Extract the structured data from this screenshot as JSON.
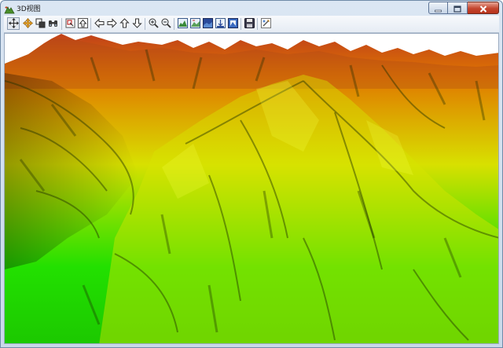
{
  "window": {
    "title": "3D视图",
    "icon": "app-icon",
    "caption_buttons": [
      {
        "name": "minimize-button",
        "icon": "minimize-icon"
      },
      {
        "name": "maximize-button",
        "icon": "maximize-icon"
      },
      {
        "name": "close-button",
        "icon": "close-icon"
      }
    ]
  },
  "toolbar": {
    "buttons": [
      {
        "name": "select-tool-button",
        "icon": "select-arrow-icon",
        "pressed": true
      },
      {
        "name": "pan-tool-button",
        "icon": "pan-icon"
      },
      {
        "name": "zoom-box-button",
        "icon": "zoom-box-icon"
      },
      {
        "name": "fly-tool-button",
        "icon": "binoculars-icon"
      },
      {
        "name": "navigate-button",
        "icon": "navigate-icon"
      },
      {
        "name": "go-up-button",
        "icon": "up-arrow-box-icon"
      },
      {
        "name": "move-left-button",
        "icon": "arrow-left-icon"
      },
      {
        "name": "move-right-button",
        "icon": "arrow-right-icon"
      },
      {
        "name": "move-up-button",
        "icon": "arrow-up-icon"
      },
      {
        "name": "move-down-button",
        "icon": "arrow-down-icon"
      },
      {
        "name": "zoom-in-button",
        "icon": "zoom-in-icon"
      },
      {
        "name": "zoom-out-button",
        "icon": "zoom-out-icon"
      },
      {
        "name": "terrain-layer-button",
        "icon": "terrain-layer-icon"
      },
      {
        "name": "terrain-edit-button",
        "icon": "terrain-edit-icon"
      },
      {
        "name": "texture-button",
        "icon": "texture-icon"
      },
      {
        "name": "elevation-button",
        "icon": "elevation-icon"
      },
      {
        "name": "exaggeration-button",
        "icon": "exaggeration-icon"
      },
      {
        "name": "save-button",
        "icon": "save-icon"
      },
      {
        "name": "settings-button",
        "icon": "settings-icon"
      }
    ]
  },
  "scene": {
    "type": "3d-terrain-elevation-view",
    "colors": {
      "low": "#22e000",
      "mid": "#d8e000",
      "high": "#e07800",
      "peak": "#c0401a",
      "background": "#ffffff"
    }
  }
}
